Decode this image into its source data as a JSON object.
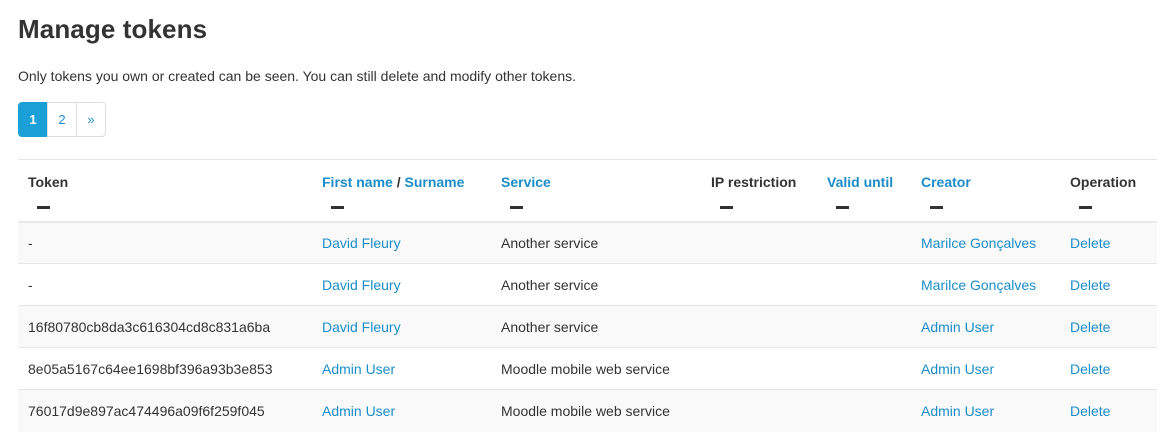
{
  "page": {
    "title": "Manage tokens",
    "intro": "Only tokens you own or created can be seen. You can still delete and modify other tokens."
  },
  "pagination": {
    "pages": [
      "1",
      "2"
    ],
    "next": "»",
    "active": "1"
  },
  "table": {
    "headers": {
      "token": "Token",
      "first_name": "First name",
      "name_sep": " / ",
      "surname": "Surname",
      "service": "Service",
      "ip_restriction": "IP restriction",
      "valid_until": "Valid until",
      "creator": "Creator",
      "operation": "Operation"
    },
    "rows": [
      {
        "token": "-",
        "user": "David Fleury",
        "service": "Another service",
        "ip": "",
        "valid": "",
        "creator": "Marilce Gonçalves",
        "operation": "Delete"
      },
      {
        "token": "-",
        "user": "David Fleury",
        "service": "Another service",
        "ip": "",
        "valid": "",
        "creator": "Marilce Gonçalves",
        "operation": "Delete"
      },
      {
        "token": "16f80780cb8da3c616304cd8c831a6ba",
        "user": "David Fleury",
        "service": "Another service",
        "ip": "",
        "valid": "",
        "creator": "Admin User",
        "operation": "Delete"
      },
      {
        "token": "8e05a5167c64ee1698bf396a93b3e853",
        "user": "Admin User",
        "service": "Moodle mobile web service",
        "ip": "",
        "valid": "",
        "creator": "Admin User",
        "operation": "Delete"
      },
      {
        "token": "76017d9e897ac474496a09f6f259f045",
        "user": "Admin User",
        "service": "Moodle mobile web service",
        "ip": "",
        "valid": "",
        "creator": "Admin User",
        "operation": "Delete"
      }
    ]
  },
  "colors": {
    "link": "#1a8dc9",
    "active_page": "#1a9fd6",
    "text": "#333333"
  }
}
